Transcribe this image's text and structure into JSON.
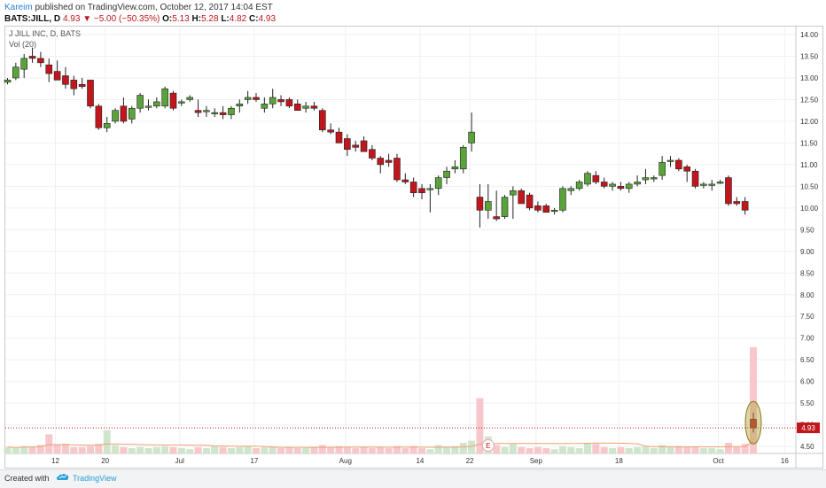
{
  "header": {
    "author": "Kareim",
    "published": " published on TradingView.com, October 12, 2017 14:04 EST",
    "symbol": "BATS:JILL, D",
    "last": "4.93",
    "change": "−5.00 (−50.35%)",
    "o_label": "O:",
    "o_val": "5.13",
    "h_label": "H:",
    "h_val": "5.28",
    "l_label": "L:",
    "l_val": "4.82",
    "c_label": "C:",
    "c_val": "4.93"
  },
  "legend": {
    "title": "J JILL INC, D, BATS",
    "volume": "Vol (20)"
  },
  "footer": {
    "created": "Created with",
    "brand": "TradingView"
  },
  "colors": {
    "up": "#5aa33a",
    "down": "#c0161c",
    "vol_up": "#cfe6cc",
    "vol_down": "#f6c8cc",
    "highlight": "#b6a23c",
    "vol_ma": "#f0a070"
  },
  "chart_data": {
    "type": "candlestick",
    "title": "J JILL INC, D, BATS",
    "ylim": [
      4.3,
      14.15
    ],
    "y_ticks": [
      "4.50",
      "5.00",
      "5.50",
      "6.00",
      "6.50",
      "7.00",
      "7.50",
      "8.00",
      "8.50",
      "9.00",
      "9.50",
      "10.00",
      "10.50",
      "11.00",
      "11.50",
      "12.00",
      "12.50",
      "13.00",
      "13.50",
      "14.00"
    ],
    "x_ticks": [
      {
        "label": "12",
        "index": 3
      },
      {
        "label": "20",
        "index": 9
      },
      {
        "label": "Jul",
        "index": 18
      },
      {
        "label": "17",
        "index": 27
      },
      {
        "label": "Aug",
        "index": 38
      },
      {
        "label": "14",
        "index": 47
      },
      {
        "label": "22",
        "index": 53
      },
      {
        "label": "Sep",
        "index": 61
      },
      {
        "label": "18",
        "index": 71
      },
      {
        "label": "Oct",
        "index": 83
      },
      {
        "label": "16",
        "index": 91
      }
    ],
    "last_price_label": "4.93",
    "earnings_marker": {
      "label": "E",
      "index": 58
    },
    "candles": [
      [
        12.9,
        13.0,
        12.85,
        12.95,
        0.06
      ],
      [
        13.0,
        13.35,
        12.95,
        13.25,
        0.05
      ],
      [
        13.2,
        13.55,
        13.0,
        13.45,
        0.07
      ],
      [
        13.5,
        13.7,
        13.35,
        13.45,
        0.06
      ],
      [
        13.45,
        13.6,
        13.25,
        13.35,
        0.08
      ],
      [
        13.3,
        13.45,
        12.9,
        13.1,
        0.18
      ],
      [
        13.15,
        13.4,
        12.95,
        12.95,
        0.08
      ],
      [
        13.05,
        13.25,
        12.75,
        12.85,
        0.09
      ],
      [
        12.95,
        13.05,
        12.6,
        12.75,
        0.06
      ],
      [
        12.85,
        13.0,
        12.75,
        12.8,
        0.06
      ],
      [
        12.95,
        12.95,
        12.3,
        12.35,
        0.07
      ],
      [
        12.35,
        12.4,
        11.8,
        11.85,
        0.09
      ],
      [
        11.85,
        12.1,
        11.75,
        11.95,
        0.22
      ],
      [
        12.0,
        12.3,
        11.95,
        12.25,
        0.08
      ],
      [
        12.35,
        12.55,
        11.95,
        12.0,
        0.06
      ],
      [
        12.05,
        12.35,
        11.95,
        12.3,
        0.05
      ],
      [
        12.3,
        12.65,
        12.2,
        12.6,
        0.06
      ],
      [
        12.35,
        12.5,
        12.25,
        12.35,
        0.05
      ],
      [
        12.35,
        12.55,
        12.3,
        12.45,
        0.06
      ],
      [
        12.35,
        12.8,
        12.3,
        12.75,
        0.07
      ],
      [
        12.65,
        12.7,
        12.25,
        12.3,
        0.06
      ],
      [
        12.45,
        12.5,
        12.35,
        12.45,
        0.05
      ],
      [
        12.5,
        12.6,
        12.45,
        12.55,
        0.04
      ],
      [
        12.25,
        12.5,
        12.1,
        12.2,
        0.06
      ],
      [
        12.25,
        12.35,
        12.1,
        12.25,
        0.05
      ],
      [
        12.2,
        12.3,
        12.1,
        12.2,
        0.07
      ],
      [
        12.2,
        12.35,
        12.05,
        12.15,
        0.06
      ],
      [
        12.15,
        12.35,
        12.05,
        12.3,
        0.05
      ],
      [
        12.35,
        12.5,
        12.2,
        12.4,
        0.06
      ],
      [
        12.5,
        12.7,
        12.4,
        12.55,
        0.07
      ],
      [
        12.55,
        12.65,
        12.45,
        12.5,
        0.05
      ],
      [
        12.3,
        12.55,
        12.2,
        12.4,
        0.06
      ],
      [
        12.4,
        12.75,
        12.3,
        12.55,
        0.07
      ],
      [
        12.5,
        12.6,
        12.35,
        12.45,
        0.05
      ],
      [
        12.5,
        12.55,
        12.3,
        12.35,
        0.06
      ],
      [
        12.4,
        12.5,
        12.25,
        12.25,
        0.05
      ],
      [
        12.3,
        12.45,
        12.2,
        12.35,
        0.05
      ],
      [
        12.35,
        12.45,
        12.25,
        12.3,
        0.06
      ],
      [
        12.25,
        12.3,
        11.75,
        11.8,
        0.08
      ],
      [
        11.8,
        11.95,
        11.7,
        11.75,
        0.06
      ],
      [
        11.75,
        11.85,
        11.5,
        11.5,
        0.07
      ],
      [
        11.6,
        11.7,
        11.2,
        11.35,
        0.06
      ],
      [
        11.45,
        11.55,
        11.3,
        11.4,
        0.05
      ],
      [
        11.55,
        11.65,
        11.3,
        11.3,
        0.06
      ],
      [
        11.35,
        11.45,
        11.1,
        11.15,
        0.05
      ],
      [
        11.15,
        11.2,
        10.8,
        11.0,
        0.06
      ],
      [
        11.1,
        11.25,
        10.95,
        11.05,
        0.05
      ],
      [
        11.15,
        11.25,
        10.6,
        10.65,
        0.07
      ],
      [
        10.65,
        10.8,
        10.55,
        10.6,
        0.05
      ],
      [
        10.6,
        10.7,
        10.25,
        10.35,
        0.07
      ],
      [
        10.45,
        10.55,
        10.2,
        10.35,
        0.05
      ],
      [
        10.45,
        10.55,
        9.9,
        10.45,
        0.04
      ],
      [
        10.45,
        10.75,
        10.3,
        10.7,
        0.08
      ],
      [
        10.7,
        10.95,
        10.55,
        10.85,
        0.06
      ],
      [
        10.9,
        11.1,
        10.8,
        10.95,
        0.07
      ],
      [
        10.9,
        11.45,
        10.8,
        11.4,
        0.1
      ],
      [
        11.5,
        12.2,
        11.3,
        11.75,
        0.12
      ],
      [
        10.25,
        10.55,
        9.55,
        9.95,
        0.52
      ],
      [
        9.95,
        10.55,
        9.75,
        10.15,
        0.16
      ],
      [
        9.8,
        10.4,
        9.7,
        9.75,
        0.08
      ],
      [
        9.8,
        10.3,
        9.75,
        10.25,
        0.06
      ],
      [
        10.3,
        10.5,
        9.75,
        10.4,
        0.09
      ],
      [
        10.4,
        10.45,
        10.1,
        10.1,
        0.06
      ],
      [
        10.3,
        10.35,
        9.95,
        10.0,
        0.05
      ],
      [
        10.05,
        10.15,
        9.9,
        9.95,
        0.06
      ],
      [
        10.05,
        10.1,
        9.9,
        9.9,
        0.05
      ],
      [
        9.95,
        10.0,
        9.85,
        9.95,
        0.04
      ],
      [
        9.95,
        10.5,
        9.9,
        10.45,
        0.07
      ],
      [
        10.4,
        10.5,
        10.3,
        10.45,
        0.06
      ],
      [
        10.45,
        10.65,
        10.4,
        10.6,
        0.05
      ],
      [
        10.55,
        10.85,
        10.5,
        10.8,
        0.1
      ],
      [
        10.75,
        10.85,
        10.55,
        10.6,
        0.09
      ],
      [
        10.6,
        10.7,
        10.45,
        10.5,
        0.06
      ],
      [
        10.5,
        10.6,
        10.4,
        10.55,
        0.05
      ],
      [
        10.5,
        10.6,
        10.4,
        10.45,
        0.06
      ],
      [
        10.45,
        10.6,
        10.35,
        10.55,
        0.05
      ],
      [
        10.55,
        10.75,
        10.5,
        10.6,
        0.06
      ],
      [
        10.65,
        10.9,
        10.55,
        10.7,
        0.07
      ],
      [
        10.7,
        10.75,
        10.6,
        10.7,
        0.05
      ],
      [
        10.75,
        11.2,
        10.65,
        11.05,
        0.08
      ],
      [
        11.1,
        11.2,
        10.95,
        11.1,
        0.06
      ],
      [
        11.1,
        11.15,
        10.85,
        10.9,
        0.07
      ],
      [
        10.95,
        11.0,
        10.6,
        10.85,
        0.06
      ],
      [
        10.85,
        10.9,
        10.45,
        10.5,
        0.06
      ],
      [
        10.55,
        10.6,
        10.45,
        10.55,
        0.05
      ],
      [
        10.55,
        10.65,
        10.4,
        10.55,
        0.05
      ],
      [
        10.6,
        10.65,
        10.55,
        10.6,
        0.04
      ],
      [
        10.7,
        10.75,
        10.05,
        10.1,
        0.1
      ],
      [
        10.15,
        10.25,
        10.05,
        10.1,
        0.06
      ],
      [
        10.15,
        10.25,
        9.85,
        9.95,
        0.09
      ],
      [
        5.13,
        5.28,
        4.82,
        4.93,
        1.0
      ]
    ]
  }
}
